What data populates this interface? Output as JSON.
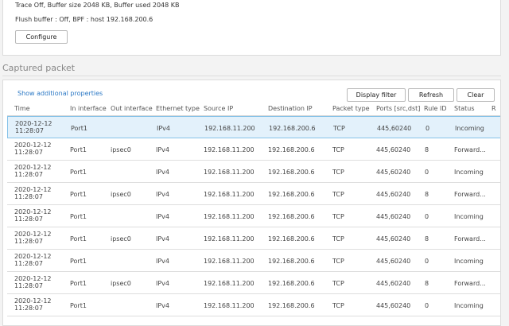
{
  "trace": {
    "status_line": "Trace Off, Buffer size 2048 KB, Buffer used 2048 KB",
    "filter_line": "Flush buffer : Off, BPF : host 192.168.200.6",
    "configure_label": "Configure"
  },
  "section": {
    "title": "Captured packet"
  },
  "toolbar": {
    "show_props_label": "Show additional properties",
    "display_filter_label": "Display filter",
    "refresh_label": "Refresh",
    "clear_label": "Clear"
  },
  "table": {
    "columns": [
      "Time",
      "In interface",
      "Out interface",
      "Ethernet type",
      "Source IP",
      "Destination IP",
      "Packet type",
      "Ports [src,dst]",
      "Rule ID",
      "Status",
      "R"
    ],
    "rows": [
      {
        "date": "2020-12-12",
        "time": "11:28:07",
        "in": "Port1",
        "out": "",
        "eth": "IPv4",
        "src": "192.168.11.200",
        "dst": "192.168.200.6",
        "ptype": "TCP",
        "ports": "445,60240",
        "rule": "0",
        "status": "Incoming"
      },
      {
        "date": "2020-12-12",
        "time": "11:28:07",
        "in": "Port1",
        "out": "ipsec0",
        "eth": "IPv4",
        "src": "192.168.11.200",
        "dst": "192.168.200.6",
        "ptype": "TCP",
        "ports": "445,60240",
        "rule": "8",
        "status": "Forward..."
      },
      {
        "date": "2020-12-12",
        "time": "11:28:07",
        "in": "Port1",
        "out": "",
        "eth": "IPv4",
        "src": "192.168.11.200",
        "dst": "192.168.200.6",
        "ptype": "TCP",
        "ports": "445,60240",
        "rule": "0",
        "status": "Incoming"
      },
      {
        "date": "2020-12-12",
        "time": "11:28:07",
        "in": "Port1",
        "out": "ipsec0",
        "eth": "IPv4",
        "src": "192.168.11.200",
        "dst": "192.168.200.6",
        "ptype": "TCP",
        "ports": "445,60240",
        "rule": "8",
        "status": "Forward..."
      },
      {
        "date": "2020-12-12",
        "time": "11:28:07",
        "in": "Port1",
        "out": "",
        "eth": "IPv4",
        "src": "192.168.11.200",
        "dst": "192.168.200.6",
        "ptype": "TCP",
        "ports": "445,60240",
        "rule": "0",
        "status": "Incoming"
      },
      {
        "date": "2020-12-12",
        "time": "11:28:07",
        "in": "Port1",
        "out": "ipsec0",
        "eth": "IPv4",
        "src": "192.168.11.200",
        "dst": "192.168.200.6",
        "ptype": "TCP",
        "ports": "445,60240",
        "rule": "8",
        "status": "Forward..."
      },
      {
        "date": "2020-12-12",
        "time": "11:28:07",
        "in": "Port1",
        "out": "",
        "eth": "IPv4",
        "src": "192.168.11.200",
        "dst": "192.168.200.6",
        "ptype": "TCP",
        "ports": "445,60240",
        "rule": "0",
        "status": "Incoming"
      },
      {
        "date": "2020-12-12",
        "time": "11:28:07",
        "in": "Port1",
        "out": "ipsec0",
        "eth": "IPv4",
        "src": "192.168.11.200",
        "dst": "192.168.200.6",
        "ptype": "TCP",
        "ports": "445,60240",
        "rule": "8",
        "status": "Forward..."
      },
      {
        "date": "2020-12-12",
        "time": "11:28:07",
        "in": "Port1",
        "out": "",
        "eth": "IPv4",
        "src": "192.168.11.200",
        "dst": "192.168.200.6",
        "ptype": "TCP",
        "ports": "445,60240",
        "rule": "0",
        "status": "Incoming"
      }
    ]
  },
  "colors": {
    "link": "#2b78c5",
    "selected_row": "#e3f1fb",
    "selected_border": "#86c2e8"
  }
}
